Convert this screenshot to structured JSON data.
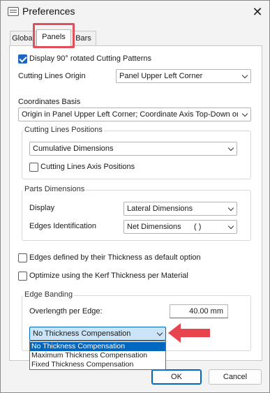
{
  "window": {
    "title": "Preferences",
    "close_glyph": "✕"
  },
  "tabs": [
    {
      "label": "Global",
      "selected": false
    },
    {
      "label": "Panels",
      "selected": true
    },
    {
      "label": "Bars",
      "selected": false
    }
  ],
  "panel": {
    "rotated_patterns": {
      "label": "Display 90° rotated Cutting Patterns",
      "checked": true
    },
    "cutting_lines_origin": {
      "label": "Cutting Lines Origin",
      "value": "Panel Upper Left Corner"
    },
    "coordinates_basis": {
      "label": "Coordinates Basis",
      "value": "Origin in Panel Upper Left Corner; Coordinate Axis Top-Down orie"
    },
    "cutting_lines_positions": {
      "title": "Cutting Lines Positions",
      "value": "Cumulative Dimensions",
      "axis_positions": {
        "label": "Cutting Lines Axis Positions",
        "checked": false
      }
    },
    "parts_dimensions": {
      "title": "Parts Dimensions",
      "display_label": "Display",
      "display_value": "Lateral Dimensions",
      "edges_label": "Edges Identification",
      "edges_value": "Net Dimensions",
      "edges_suffix": "( )"
    },
    "edges_thickness": {
      "label": "Edges defined by their Thickness as default option",
      "checked": false
    },
    "kerf_thickness": {
      "label": "Optimize using the Kerf Thickness per Material",
      "checked": false
    },
    "edge_banding": {
      "title": "Edge Banding",
      "overlength_label": "Overlength per Edge:",
      "overlength_value": "40.00 mm",
      "compensation_value": "No Thickness Compensation",
      "options": [
        {
          "label": "No Thickness Compensation",
          "selected": true
        },
        {
          "label": "Maximum Thickness Compensation",
          "selected": false
        },
        {
          "label": "Fixed Thickness Compensation",
          "selected": false
        }
      ]
    }
  },
  "buttons": {
    "ok": "OK",
    "cancel": "Cancel"
  },
  "colors": {
    "accent": "#1e64c8",
    "selection": "#0067c0",
    "highlight": "#e0505a",
    "arrow": "#e8444e"
  }
}
